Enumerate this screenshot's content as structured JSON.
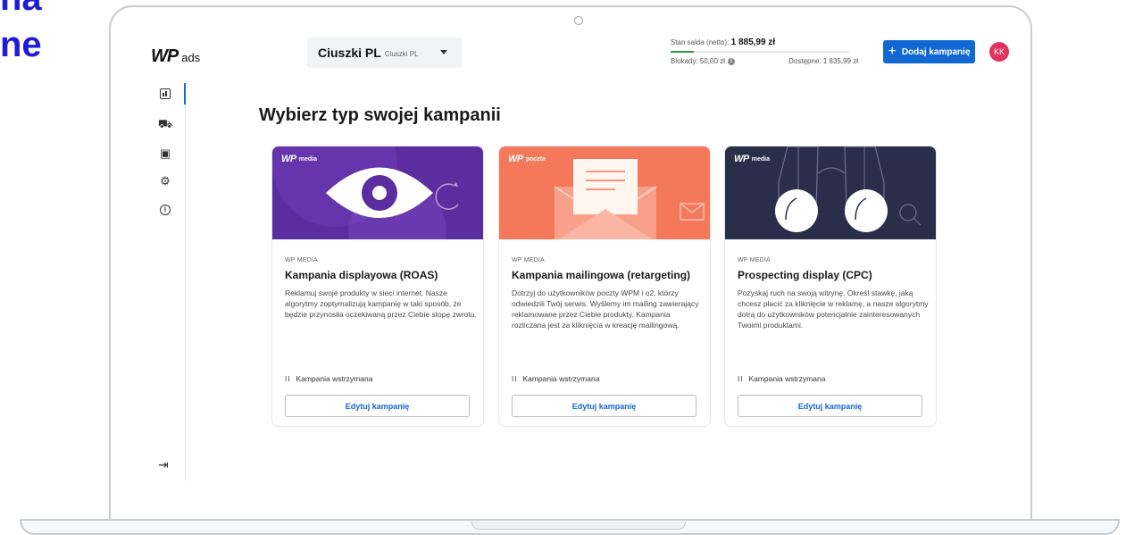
{
  "edge_headline": {
    "line1": "na",
    "line2": "ne",
    "color": "#1f1bd6"
  },
  "topbar": {
    "logo_mark": "WP",
    "logo_suffix": "ads",
    "account": {
      "name": "Ciuszki PL",
      "sub": "Ciuszki PL"
    },
    "balance": {
      "label": "Stan salda (netto):",
      "value": "1 885,99 zł",
      "fill_fraction": 0.13,
      "blocked": "Blokady: 50,00 zł",
      "available": "Dostępne: 1 835,99 zł"
    },
    "add_button": {
      "plus": "+",
      "label": "Dodaj kampanię"
    },
    "avatar": "KK"
  },
  "sidenav": {
    "items": [
      {
        "icon": "chart-icon",
        "active": true
      },
      {
        "icon": "cart-icon",
        "glyph": "⛟"
      },
      {
        "icon": "wallet-icon",
        "glyph": "▣"
      },
      {
        "icon": "settings-icon",
        "glyph": "⚙"
      },
      {
        "icon": "info-icon",
        "glyph": "i"
      }
    ],
    "logout_glyph": "⇥"
  },
  "main": {
    "title": "Wybierz typ swojej kampanii",
    "cards": [
      {
        "brand": "media",
        "brand_mark": "WP",
        "eyebrow": "WP MEDIA",
        "title": "Kampania displayowa (ROAS)",
        "description": "Reklamuj swoje produkty w sieci internet. Nasze algorytmy zoptymalizują kampanię w taki sposób, że będzie przynosiła oczekiwaną przez Ciebie stopę zwrotu.",
        "status_icon": "II",
        "status": "Kampania wstrzymana",
        "button": "Edytuj kampanię",
        "color": "#5b2d9e"
      },
      {
        "brand": "poczta",
        "brand_mark": "WP",
        "eyebrow": "WP MEDIA",
        "title": "Kampania mailingowa (retargeting)",
        "description": "Dotrzyj do użytkowników poczty WPM i o2, którzy odwiedzili Twój serwis. Wyślemy im mailing zawierający reklamowane przez Ciebie produkty. Kampania rozliczana jest za kliknięcia w kreację mailingową.",
        "status_icon": "II",
        "status": "Kampania wstrzymana",
        "button": "Edytuj kampanię",
        "color": "#f4785a"
      },
      {
        "brand": "media",
        "brand_mark": "WP",
        "eyebrow": "WP MEDIA",
        "title": "Prospecting display (CPC)",
        "description": "Pozyskaj ruch na swoją witrynę. Określ stawkę, jaką chcesz płacić za kliknięcie w reklamę, a nasze algorytmy dotrą do użytkowników potencjalnie zainteresowanych Twoimi produktami.",
        "status_icon": "II",
        "status": "Kampania wstrzymana",
        "button": "Edytuj kampanię",
        "color": "#2b2e4a"
      }
    ]
  },
  "colors": {
    "accent": "#1268d3",
    "avatar": "#e0335f",
    "balance_bar": "#2e9b47"
  }
}
